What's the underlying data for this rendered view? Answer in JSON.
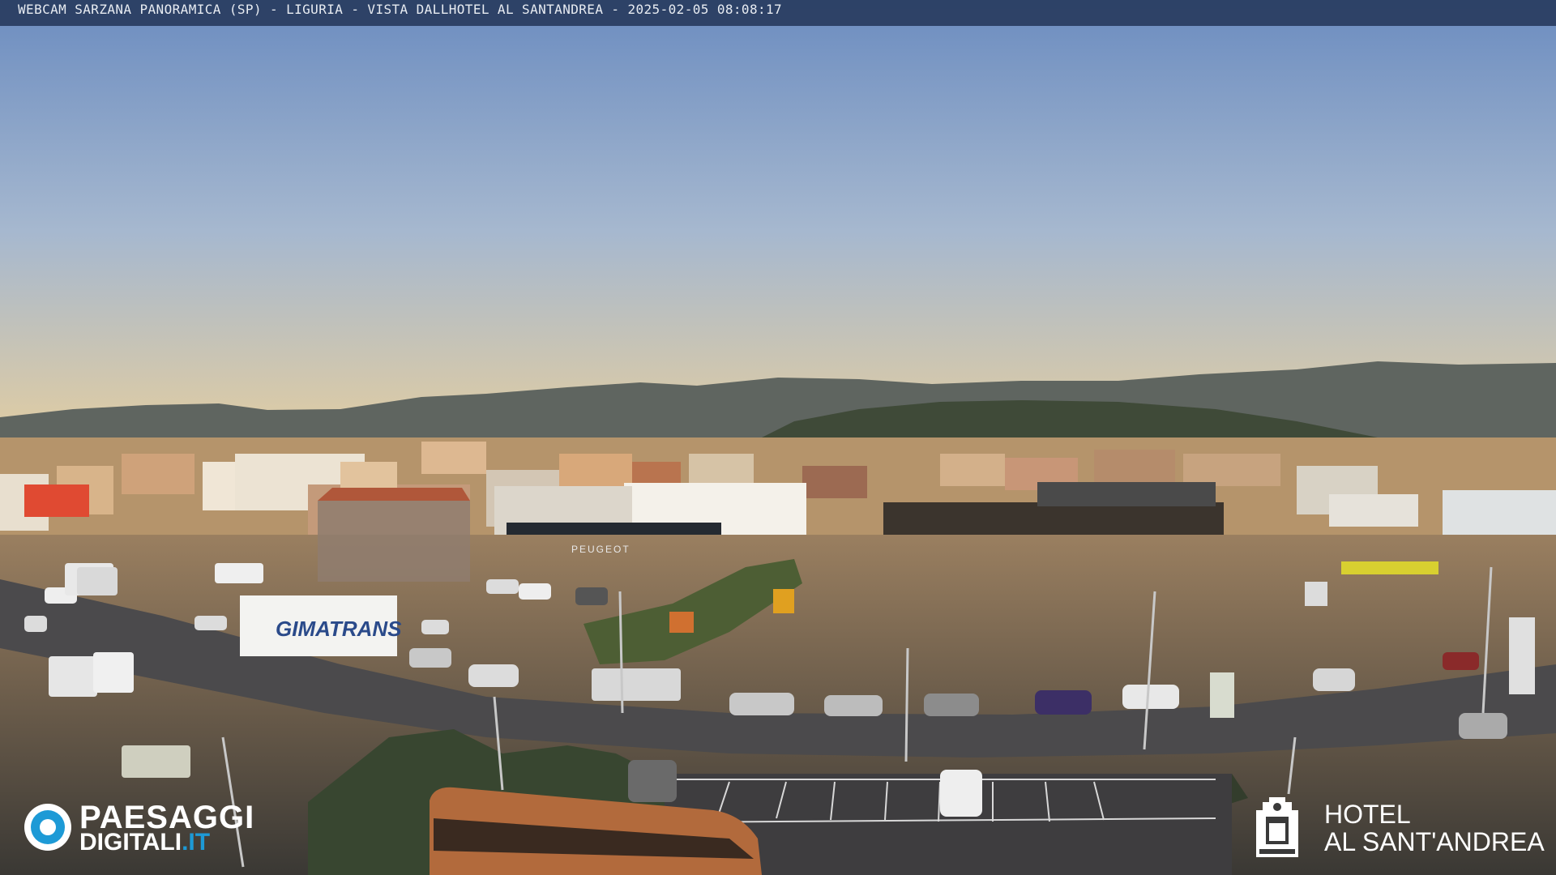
{
  "caption": "WEBCAM SARZANA PANORAMICA (SP) - LIGURIA - VISTA DALLHOTEL AL SANTANDREA - 2025-02-05  08:08:17",
  "logo_left": {
    "word1": "PAESAGGI",
    "word2": "DIGITALI",
    "word3": ".IT"
  },
  "logo_right": {
    "line1": "HOTEL",
    "line2": "AL SANT'ANDREA"
  },
  "signs": {
    "truck": "GIMATRANS",
    "dealer": "PEUGEOT"
  },
  "colors": {
    "sky_top": "#6b8cc0",
    "sky_bottom": "#d8c9a6",
    "brand_blue": "#1d9ad6"
  }
}
